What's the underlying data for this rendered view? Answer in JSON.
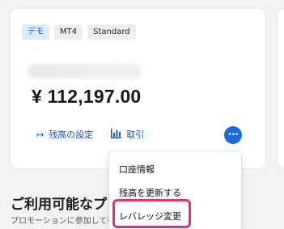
{
  "account": {
    "badges": [
      "デモ",
      "MT4",
      "Standard"
    ],
    "balance": "¥ 112,197.00"
  },
  "actions": {
    "balance_settings": "残高の設定",
    "trade": "取引"
  },
  "more_button": "•••",
  "menu": {
    "items": [
      "口座情報",
      "残高を更新する",
      "レバレッジ変更"
    ]
  },
  "section": {
    "title": "ご利用可能なプ",
    "subtitle": "プロモーションに参加して豪言"
  },
  "colors": {
    "accent": "#1a6be0",
    "highlight": "#e8306a",
    "demo_badge": "#dce9ff"
  }
}
